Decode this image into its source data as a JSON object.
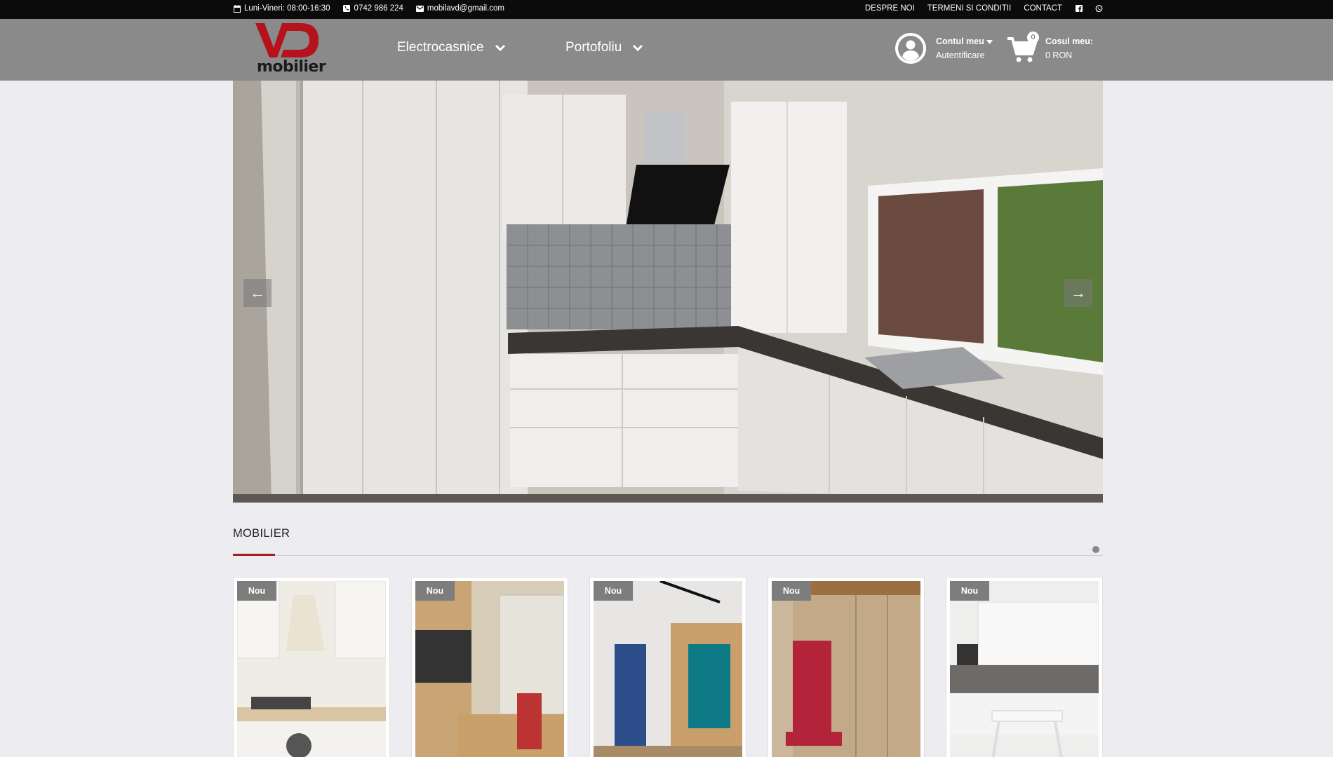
{
  "topbar": {
    "hours": "Luni-Vineri: 08:00-16:30",
    "phone": "0742 986 224",
    "email": "mobilavd@gmail.com",
    "links": [
      "DESPRE NOI",
      "TERMENI SI CONDITII",
      "CONTACT"
    ],
    "social_icons": [
      "facebook-icon",
      "whatsapp-icon"
    ]
  },
  "header": {
    "logo_text": "mobilier",
    "logo_mark": "VD",
    "nav": [
      {
        "label": "Electrocasnice",
        "icon": "chevron-down-icon"
      },
      {
        "label": "Portofoliu",
        "icon": "chevron-down-icon"
      }
    ],
    "account": {
      "title": "Contul meu",
      "subtitle": "Autentificare"
    },
    "cart": {
      "count": "0",
      "title": "Cosul meu:",
      "total": "0 RON"
    }
  },
  "slider": {
    "prev_label": "←",
    "next_label": "→"
  },
  "section": {
    "title": "MOBILIER"
  },
  "products": [
    {
      "badge": "Nou"
    },
    {
      "badge": "Nou"
    },
    {
      "badge": "Nou"
    },
    {
      "badge": "Nou"
    },
    {
      "badge": "Nou"
    }
  ],
  "colors": {
    "topbar_bg": "#0b0b0b",
    "header_bg": "#8a8a8a",
    "brand_red": "#a61d20",
    "page_bg": "#ececf1"
  }
}
